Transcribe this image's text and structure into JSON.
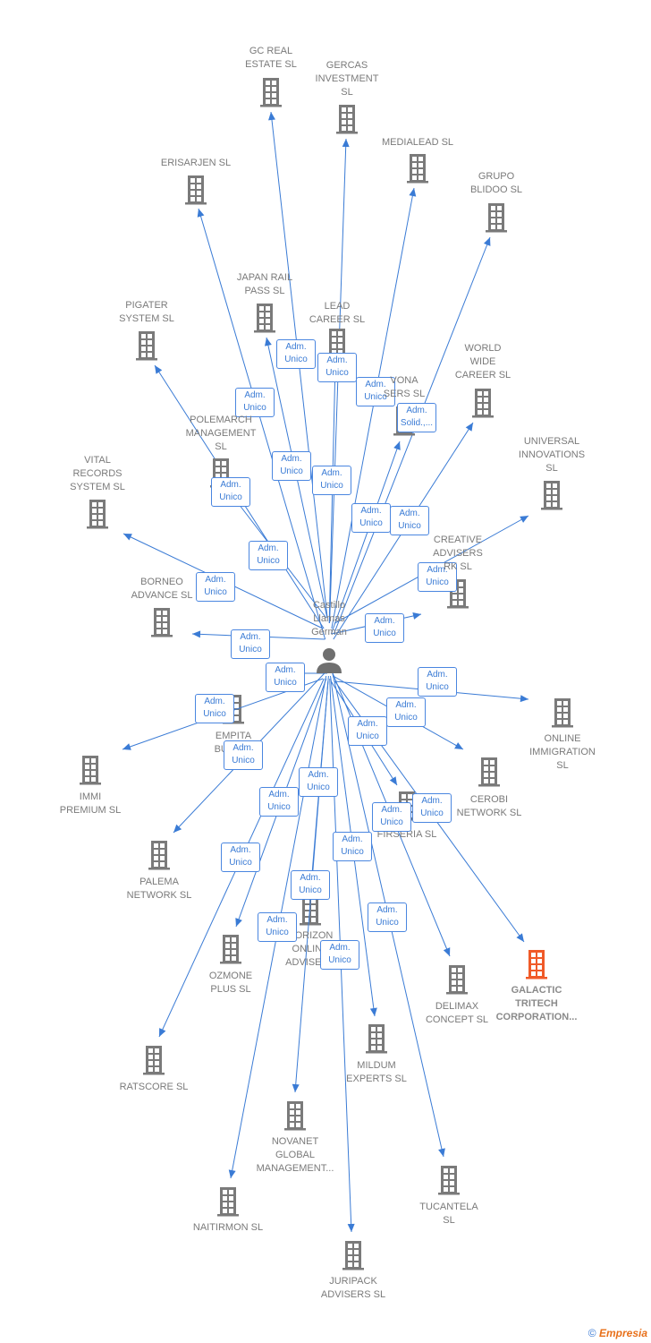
{
  "center": {
    "name": "Castillo\nLlamas\nGerman",
    "icon": "person-icon"
  },
  "colors": {
    "edge": "#3a7bd5",
    "node": "#7a7a7a",
    "highlight": "#f05a28"
  },
  "nodes": [
    {
      "label": "GC REAL\nESTATE  SL",
      "role": "Adm.\nUnico"
    },
    {
      "label": "GERCAS\nINVESTMENT\nSL",
      "role": "Adm.\nUnico"
    },
    {
      "label": "MEDIALEAD  SL",
      "role": "Adm.\nUnico"
    },
    {
      "label": "GRUPO\nBLIDOO SL",
      "role": "Adm.\nSolid.,..."
    },
    {
      "label": "ERISARJEN  SL",
      "role": "Adm.\nUnico"
    },
    {
      "label": "JAPAN RAIL\nPASS  SL",
      "role": "Adm.\nUnico"
    },
    {
      "label": "LEAD\nCAREER  SL",
      "role": "Adm.\nUnico"
    },
    {
      "label": "PIGATER\nSYSTEM  SL",
      "role": "Adm.\nUnico"
    },
    {
      "label": "VONA\nSERS  SL",
      "role": "Adm.\nUnico"
    },
    {
      "label": "WORLD\nWIDE\nCAREER  SL",
      "role": "Adm.\nUnico"
    },
    {
      "label": "POLEMARCH\nMANAGEMENT\nSL",
      "role": "Adm.\nUnico"
    },
    {
      "label": "UNIVERSAL\nINNOVATIONS\nSL",
      "role": "Adm.\nUnico"
    },
    {
      "label": "VITAL\nRECORDS\nSYSTEM  SL",
      "role": "Adm.\nUnico"
    },
    {
      "label": "CREATIVE\nADVISERS\nRK  SL",
      "role": "Adm.\nUnico"
    },
    {
      "label": "BORNEO\nADVANCE  SL",
      "role": "Adm.\nUnico"
    },
    {
      "label": "ONLINE\nIMMIGRATION\nSL",
      "role": "Adm.\nUnico"
    },
    {
      "label": "EMPITA\nBUSIN...",
      "role": "Adm.\nUnico"
    },
    {
      "label": "CEROBI\nNETWORK  SL",
      "role": "Adm.\nUnico"
    },
    {
      "label": "IMMI\nPREMIUM  SL",
      "role": "Adm.\nUnico"
    },
    {
      "label": "FIRSERIA SL",
      "role": "Adm.\nUnico"
    },
    {
      "label": "PALEMA\nNETWORK  SL",
      "role": "Adm.\nUnico"
    },
    {
      "label": "HORIZON\nONLINE\nADVISERS",
      "role": "Adm.\nUnico"
    },
    {
      "label": "OZMONE\nPLUS  SL",
      "role": "Adm.\nUnico"
    },
    {
      "label": "GALACTIC\nTRITECH\nCORPORATION...",
      "role": "Adm.\nUnico",
      "highlight": true
    },
    {
      "label": "DELIMAX\nCONCEPT  SL",
      "role": "Adm.\nUnico"
    },
    {
      "label": "MILDUM\nEXPERTS  SL",
      "role": "Adm.\nUnico"
    },
    {
      "label": "RATSCORE  SL",
      "role": "Adm.\nUnico"
    },
    {
      "label": "NOVANET\nGLOBAL\nMANAGEMENT...",
      "role": "Adm.\nUnico"
    },
    {
      "label": "TUCANTELA\nSL",
      "role": "Adm.\nUnico"
    },
    {
      "label": "NAITIRMON  SL",
      "role": "Adm.\nUnico"
    },
    {
      "label": "JURIPACK\nADVISERS  SL",
      "role": "Adm.\nUnico"
    }
  ],
  "footer": {
    "copyright": "©",
    "brand": "Empresia"
  }
}
